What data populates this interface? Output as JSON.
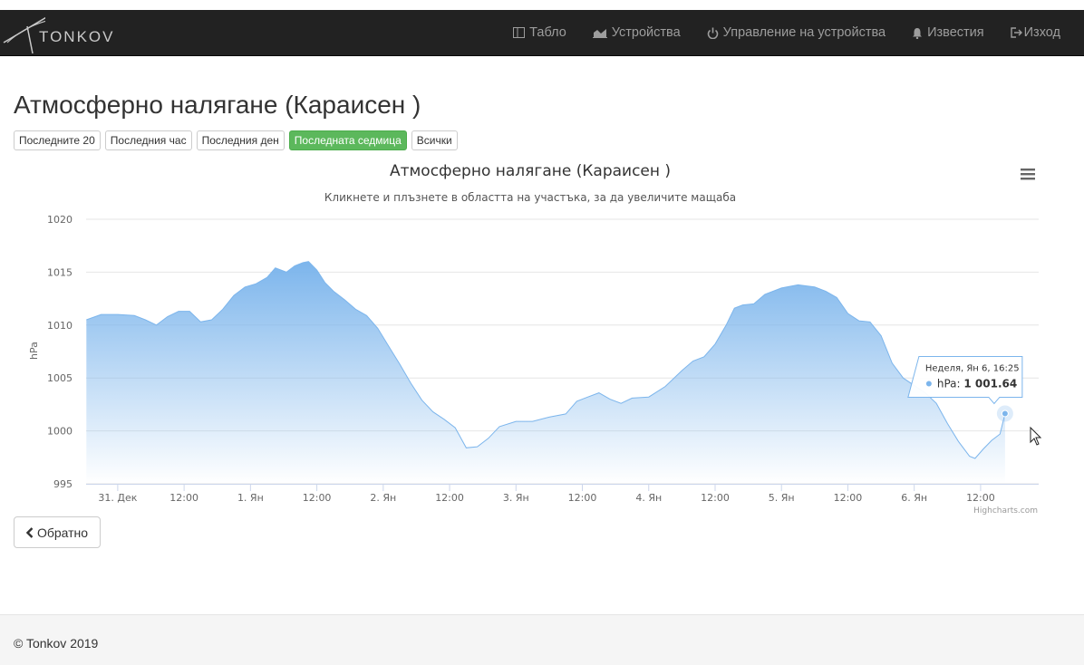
{
  "brand": {
    "name": "TONKOV"
  },
  "nav": {
    "items": [
      {
        "label": "Табло",
        "icon": "dashboard-icon"
      },
      {
        "label": "Устройства",
        "icon": "area-chart-icon"
      },
      {
        "label": "Управление на устройства",
        "icon": "power-icon"
      },
      {
        "label": "Известия",
        "icon": "bell-icon"
      },
      {
        "label": "Изход",
        "icon": "sign-out-icon"
      }
    ]
  },
  "page": {
    "title": "Атмосферно налягане (Караисен )"
  },
  "filters": {
    "active_color": "#5cb85c",
    "buttons": [
      {
        "label": "Последните 20",
        "active": false
      },
      {
        "label": "Последния час",
        "active": false
      },
      {
        "label": "Последния ден",
        "active": false
      },
      {
        "label": "Последната седмица",
        "active": true
      },
      {
        "label": "Всички",
        "active": false
      }
    ]
  },
  "chart_data": {
    "type": "area",
    "title": "Атмосферно налягане (Караисен )",
    "subtitle": "Кликнете и плъзнете в областта на участъка, за да увеличите мащаба",
    "ylabel": "hPa",
    "ylim": [
      995,
      1020
    ],
    "yticks": [
      1020,
      1015,
      1010,
      1005,
      1000,
      995
    ],
    "xlim": [
      "2018-12-30T18:17",
      "2019-01-06T22:30"
    ],
    "xticks": [
      {
        "t": "2018-12-31T00:00",
        "label": "31. Дек"
      },
      {
        "t": "2018-12-31T12:00",
        "label": "12:00"
      },
      {
        "t": "2019-01-01T00:00",
        "label": "1. Ян"
      },
      {
        "t": "2019-01-01T12:00",
        "label": "12:00"
      },
      {
        "t": "2019-01-02T00:00",
        "label": "2. Ян"
      },
      {
        "t": "2019-01-02T12:00",
        "label": "12:00"
      },
      {
        "t": "2019-01-03T00:00",
        "label": "3. Ян"
      },
      {
        "t": "2019-01-03T12:00",
        "label": "12:00"
      },
      {
        "t": "2019-01-04T00:00",
        "label": "4. Ян"
      },
      {
        "t": "2019-01-04T12:00",
        "label": "12:00"
      },
      {
        "t": "2019-01-05T00:00",
        "label": "5. Ян"
      },
      {
        "t": "2019-01-05T12:00",
        "label": "12:00"
      },
      {
        "t": "2019-01-06T00:00",
        "label": "6. Ян"
      },
      {
        "t": "2019-01-06T12:00",
        "label": "12:00"
      }
    ],
    "grid": true,
    "legend": false,
    "series": [
      {
        "color": "#7cb5ec",
        "points": [
          [
            "2018-12-30T18:20",
            1010.5
          ],
          [
            "2018-12-30T21:00",
            1011.0
          ],
          [
            "2018-12-31T00:00",
            1011.0
          ],
          [
            "2018-12-31T03:00",
            1010.9
          ],
          [
            "2018-12-31T05:00",
            1010.5
          ],
          [
            "2018-12-31T07:00",
            1010.0
          ],
          [
            "2018-12-31T09:00",
            1010.8
          ],
          [
            "2018-12-31T11:00",
            1011.3
          ],
          [
            "2018-12-31T13:00",
            1011.3
          ],
          [
            "2018-12-31T15:00",
            1010.3
          ],
          [
            "2018-12-31T17:00",
            1010.5
          ],
          [
            "2018-12-31T19:00",
            1011.5
          ],
          [
            "2018-12-31T21:00",
            1012.8
          ],
          [
            "2018-12-31T23:00",
            1013.6
          ],
          [
            "2019-01-01T01:00",
            1013.9
          ],
          [
            "2019-01-01T03:00",
            1014.5
          ],
          [
            "2019-01-01T04:30",
            1015.4
          ],
          [
            "2019-01-01T06:30",
            1015.0
          ],
          [
            "2019-01-01T08:00",
            1015.6
          ],
          [
            "2019-01-01T09:30",
            1015.9
          ],
          [
            "2019-01-01T10:30",
            1016.0
          ],
          [
            "2019-01-01T12:00",
            1015.2
          ],
          [
            "2019-01-01T13:30",
            1014.0
          ],
          [
            "2019-01-01T15:00",
            1013.2
          ],
          [
            "2019-01-01T17:00",
            1012.4
          ],
          [
            "2019-01-01T19:00",
            1011.5
          ],
          [
            "2019-01-01T21:00",
            1010.9
          ],
          [
            "2019-01-01T23:00",
            1009.7
          ],
          [
            "2019-01-02T01:00",
            1008.0
          ],
          [
            "2019-01-02T03:00",
            1006.3
          ],
          [
            "2019-01-02T05:00",
            1004.5
          ],
          [
            "2019-01-02T07:00",
            1002.9
          ],
          [
            "2019-01-02T09:00",
            1001.8
          ],
          [
            "2019-01-02T11:00",
            1001.1
          ],
          [
            "2019-01-02T13:00",
            1000.3
          ],
          [
            "2019-01-02T15:00",
            998.4
          ],
          [
            "2019-01-02T17:00",
            998.5
          ],
          [
            "2019-01-02T19:00",
            999.3
          ],
          [
            "2019-01-02T21:00",
            1000.4
          ],
          [
            "2019-01-03T00:00",
            1000.9
          ],
          [
            "2019-01-03T03:00",
            1000.9
          ],
          [
            "2019-01-03T06:00",
            1001.3
          ],
          [
            "2019-01-03T09:00",
            1001.6
          ],
          [
            "2019-01-03T11:00",
            1002.8
          ],
          [
            "2019-01-03T13:00",
            1003.2
          ],
          [
            "2019-01-03T15:00",
            1003.6
          ],
          [
            "2019-01-03T17:00",
            1003.0
          ],
          [
            "2019-01-03T19:00",
            1002.6
          ],
          [
            "2019-01-03T21:00",
            1003.1
          ],
          [
            "2019-01-04T00:00",
            1003.2
          ],
          [
            "2019-01-04T03:00",
            1004.2
          ],
          [
            "2019-01-04T06:00",
            1005.7
          ],
          [
            "2019-01-04T08:00",
            1006.6
          ],
          [
            "2019-01-04T10:00",
            1007.0
          ],
          [
            "2019-01-04T12:00",
            1008.2
          ],
          [
            "2019-01-04T14:00",
            1010.0
          ],
          [
            "2019-01-04T15:30",
            1011.6
          ],
          [
            "2019-01-04T17:00",
            1011.9
          ],
          [
            "2019-01-04T19:00",
            1012.0
          ],
          [
            "2019-01-04T21:00",
            1012.9
          ],
          [
            "2019-01-05T00:00",
            1013.5
          ],
          [
            "2019-01-05T03:00",
            1013.8
          ],
          [
            "2019-01-05T06:00",
            1013.6
          ],
          [
            "2019-01-05T08:00",
            1013.2
          ],
          [
            "2019-01-05T10:00",
            1012.6
          ],
          [
            "2019-01-05T12:00",
            1011.1
          ],
          [
            "2019-01-05T14:00",
            1010.4
          ],
          [
            "2019-01-05T16:00",
            1010.3
          ],
          [
            "2019-01-05T18:00",
            1009.0
          ],
          [
            "2019-01-05T20:00",
            1006.4
          ],
          [
            "2019-01-05T22:00",
            1005.0
          ],
          [
            "2019-01-06T00:00",
            1004.3
          ],
          [
            "2019-01-06T02:00",
            1003.6
          ],
          [
            "2019-01-06T04:00",
            1002.6
          ],
          [
            "2019-01-06T06:00",
            1000.7
          ],
          [
            "2019-01-06T08:00",
            999.0
          ],
          [
            "2019-01-06T10:00",
            997.6
          ],
          [
            "2019-01-06T11:00",
            997.4
          ],
          [
            "2019-01-06T12:30",
            998.3
          ],
          [
            "2019-01-06T14:00",
            999.1
          ],
          [
            "2019-01-06T15:30",
            999.7
          ],
          [
            "2019-01-06T16:25",
            1001.64
          ]
        ]
      }
    ],
    "tooltip": {
      "date": "Неделя, Ян 6, 16:25",
      "series": "hPa",
      "value": "1 001.64"
    },
    "credits": "Highcharts.com",
    "menu_icon": "hamburger-menu-icon"
  },
  "back_button": {
    "label": "Обратно",
    "icon": "chevron-left-icon"
  },
  "footer": {
    "text": "© Tonkov 2019"
  }
}
